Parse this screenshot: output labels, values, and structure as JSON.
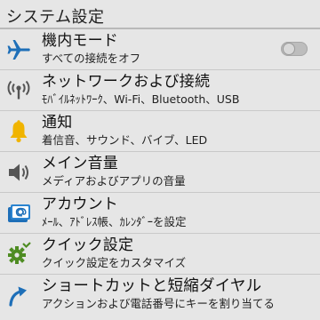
{
  "header": {
    "title": "システム設定"
  },
  "colors": {
    "background": "#e6e6e6",
    "icon_blue": "#1e6fb8",
    "icon_yellow": "#f0b400",
    "icon_green": "#4e8c22"
  },
  "items": [
    {
      "icon": "airplane-icon",
      "title": "機内モード",
      "subtitle": "すべての接続をオフ",
      "toggle_state": "off"
    },
    {
      "icon": "network-signal-icon",
      "title": "ネットワークおよび接続",
      "subtitle": "ﾓﾊﾞｲﾙﾈｯﾄﾜｰｸ、Wi-Fi、Bluetooth、USB"
    },
    {
      "icon": "bell-icon",
      "title": "通知",
      "subtitle": "着信音、サウンド、バイブ、LED"
    },
    {
      "icon": "speaker-icon",
      "title": "メイン音量",
      "subtitle": "メディアおよびアプリの音量"
    },
    {
      "icon": "account-icon",
      "title": "アカウント",
      "subtitle": "ﾒｰﾙ、ｱﾄﾞﾚｽ帳、ｶﾚﾝﾀﾞｰを設定"
    },
    {
      "icon": "quick-settings-icon",
      "title": "クイック設定",
      "subtitle": "クイック設定をカスタマイズ"
    },
    {
      "icon": "shortcut-arrow-icon",
      "title": "ショートカットと短縮ダイヤル",
      "subtitle": "アクションおよび電話番号にキーを割り当てる"
    }
  ]
}
